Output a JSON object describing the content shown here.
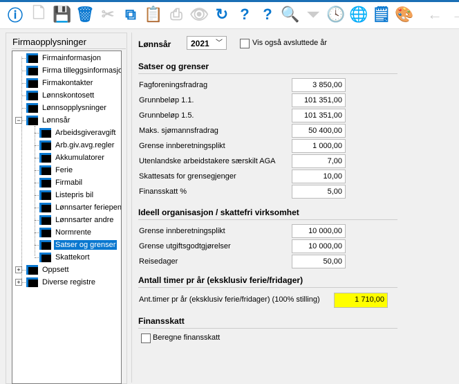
{
  "toolbar": [
    {
      "name": "info-icon",
      "glyph": "ⓘ",
      "enabled": true
    },
    {
      "name": "new-document-icon",
      "glyph": "🗋",
      "enabled": false
    },
    {
      "name": "save-icon",
      "glyph": "💾",
      "enabled": true
    },
    {
      "name": "delete-icon",
      "glyph": "🗑",
      "enabled": true
    },
    {
      "name": "cut-icon",
      "glyph": "✂",
      "enabled": false
    },
    {
      "name": "copy-icon",
      "glyph": "⧉",
      "enabled": true
    },
    {
      "name": "paste-icon",
      "glyph": "📋",
      "enabled": true
    },
    {
      "name": "print-icon",
      "glyph": "⎙",
      "enabled": false
    },
    {
      "name": "preview-eye-icon",
      "glyph": "👁",
      "enabled": false
    },
    {
      "name": "refresh-icon",
      "glyph": "↻",
      "enabled": true
    },
    {
      "name": "help-icon",
      "glyph": "?",
      "enabled": true
    },
    {
      "name": "document-help-icon",
      "glyph": "?",
      "enabled": true
    },
    {
      "name": "search-icon",
      "glyph": "🔍",
      "enabled": false
    },
    {
      "name": "filter-icon",
      "glyph": "⏷",
      "enabled": false
    },
    {
      "name": "history-clock-icon",
      "glyph": "🕓",
      "enabled": true
    },
    {
      "name": "globe-icon",
      "glyph": "🌐",
      "enabled": false
    },
    {
      "name": "note-icon",
      "glyph": "🗒",
      "enabled": true
    },
    {
      "name": "palette-icon",
      "glyph": "🎨",
      "enabled": true
    },
    {
      "name": "back-arrow-icon",
      "glyph": "←",
      "enabled": false
    },
    {
      "name": "forward-arrow-icon",
      "glyph": "→",
      "enabled": false
    }
  ],
  "left": {
    "title": "Firmaopplysninger",
    "tree": [
      {
        "label": "Firmainformasjon",
        "level": 1
      },
      {
        "label": "Firma tilleggsinformasjon",
        "level": 1
      },
      {
        "label": "Firmakontakter",
        "level": 1
      },
      {
        "label": "Lønnskontosett",
        "level": 1
      },
      {
        "label": "Lønnsopplysninger",
        "level": 1
      },
      {
        "label": "Lønnsår",
        "level": 1,
        "toggle": "−"
      },
      {
        "label": "Arbeidsgiveravgift",
        "level": 2
      },
      {
        "label": "Arb.giv.avg.regler",
        "level": 2
      },
      {
        "label": "Akkumulatorer",
        "level": 2
      },
      {
        "label": "Ferie",
        "level": 2
      },
      {
        "label": "Firmabil",
        "level": 2
      },
      {
        "label": "Listepris bil",
        "level": 2
      },
      {
        "label": "Lønnsarter feriepenger",
        "level": 2
      },
      {
        "label": "Lønnsarter andre",
        "level": 2
      },
      {
        "label": "Normrente",
        "level": 2
      },
      {
        "label": "Satser og grenser",
        "level": 2,
        "selected": true
      },
      {
        "label": "Skattekort",
        "level": 2
      },
      {
        "label": "Oppsett",
        "level": 1,
        "toggle": "+"
      },
      {
        "label": "Diverse registre",
        "level": 1,
        "toggle": "+"
      }
    ]
  },
  "main": {
    "year_label": "Lønnsår",
    "year_value": "2021",
    "show_closed_label": "Vis også avsluttede år",
    "sections": [
      {
        "title": "Satser og grenser",
        "rows": [
          {
            "label": "Fagforeningsfradrag",
            "value": "3 850,00"
          },
          {
            "label": "Grunnbeløp 1.1.",
            "value": "101 351,00"
          },
          {
            "label": "Grunnbeløp 1.5.",
            "value": "101 351,00"
          },
          {
            "label": "Maks. sjømannsfradrag",
            "value": "50 400,00"
          },
          {
            "label": "Grense innberetningsplikt",
            "value": "1 000,00"
          },
          {
            "label": "Utenlandske arbeidstakere særskilt AGA",
            "value": "7,00"
          },
          {
            "label": "Skattesats for grensegjenger",
            "value": "10,00"
          },
          {
            "label": "Finansskatt %",
            "value": "5,00"
          }
        ]
      },
      {
        "title": "Ideell organisasjon / skattefri virksomhet",
        "rows": [
          {
            "label": "Grense innberetningsplikt",
            "value": "10 000,00"
          },
          {
            "label": "Grense utgiftsgodtgjørelser",
            "value": "10 000,00"
          },
          {
            "label": "Reisedager",
            "value": "50,00"
          }
        ]
      },
      {
        "title": "Antall timer pr år (eksklusiv ferie/fridager)",
        "rows": [
          {
            "label": "Ant.timer pr år (eksklusiv ferie/fridager) (100% stilling)",
            "value": "1 710,00"
          }
        ]
      },
      {
        "title": "Finansskatt",
        "checkbox_label": "Beregne finansskatt"
      }
    ]
  }
}
